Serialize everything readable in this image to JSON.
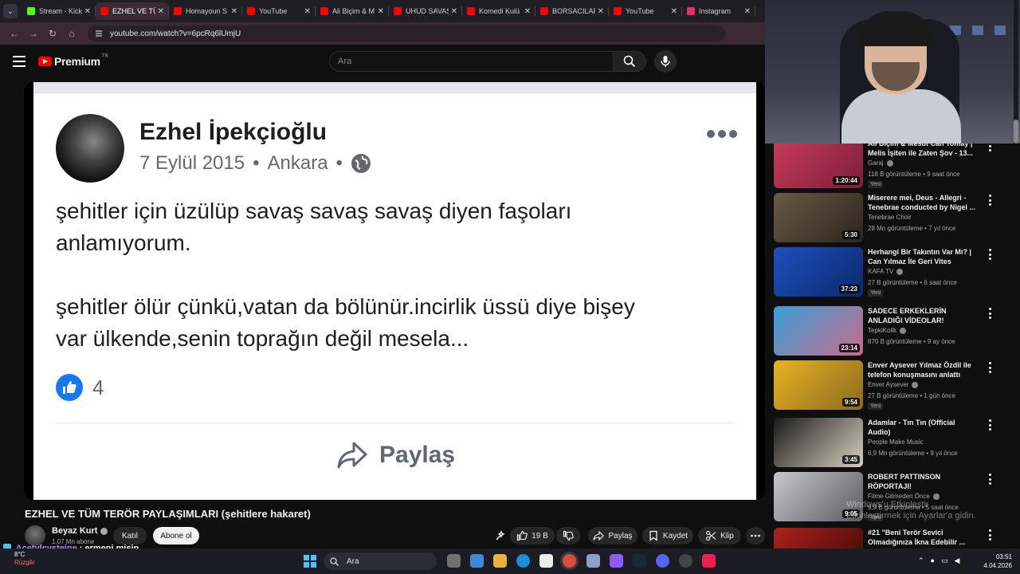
{
  "browser": {
    "tabs": [
      {
        "title": "Stream - Kick",
        "color": "#53fc18"
      },
      {
        "title": "EZHEL VE TÜ",
        "color": "#ff0000",
        "active": true
      },
      {
        "title": "Homayoun S",
        "color": "#ff0000"
      },
      {
        "title": "YouTube",
        "color": "#ff0000"
      },
      {
        "title": "Ali Biçim & M",
        "color": "#ff0000"
      },
      {
        "title": "UHUD SAVAŞ",
        "color": "#ff0000"
      },
      {
        "title": "Komedi Kulü",
        "color": "#ff0000"
      },
      {
        "title": "BORSACILAR",
        "color": "#ff0000"
      },
      {
        "title": "YouTube",
        "color": "#ff0000"
      },
      {
        "title": "Instagram",
        "color": "#e1306c"
      }
    ],
    "url": "youtube.com/watch?v=6pcRq6lUmjU"
  },
  "youtube": {
    "logo_text": "Premium",
    "logo_badge": "TR",
    "search_placeholder": "Ara"
  },
  "post": {
    "author": "Ezhel İpekçioğlu",
    "date": "7 Eylül 2015",
    "location": "Ankara",
    "dot": "•",
    "text": "şehitler için üzülüp savaş savaş savaş diyen faşoları\nanlamıyorum.\n\nşehitler ölür çünkü,vatan da bölünür.incirlik üssü diye bişey\nvar ülkende,senin toprağın değil mesela...",
    "likes": "4",
    "share_label": "Paylaş"
  },
  "video": {
    "title": "EZHEL VE TÜM TERÖR PAYLAŞIMLARI (şehitlere hakaret)",
    "channel": "Beyaz Kurt",
    "subscribers": "1,07 Mn abone",
    "join_label": "Katıl",
    "subscribe_label": "Abone ol",
    "like_count": "19 B",
    "share_label": "Paylaş",
    "save_label": "Kaydet",
    "clip_label": "Klip"
  },
  "chat": {
    "user": "Acetylcysteine",
    "sep": ":",
    "message": "ermeni misin"
  },
  "recommendations": [
    {
      "title": "Ali Biçim & Mesut Can Tomay | Melis İşiten ile Zaten Şov - 13...",
      "channel": "Garaj",
      "verified": true,
      "views": "118 B görüntüleme • 9 saat önce",
      "badge": "Yeni",
      "duration": "1:20:44",
      "thumb": [
        "#c93b5a",
        "#7a1f3a"
      ]
    },
    {
      "title": "Miserere mei, Deus - Allegri - Tenebrae conducted by Nigel ...",
      "channel": "Tenebrae Choir",
      "verified": false,
      "views": "28 Mn görüntüleme • 7 yıl önce",
      "badge": "",
      "duration": "5:30",
      "thumb": [
        "#6a5a48",
        "#2c241c"
      ]
    },
    {
      "title": "Herhangi Bir Takıntın Var Mı? | Can Yılmaz İle Geri Vites",
      "channel": "KAFA TV",
      "verified": true,
      "views": "27 B görüntüleme • 6 saat önce",
      "badge": "Yeni",
      "duration": "37:23",
      "thumb": [
        "#1e4fbf",
        "#0b2a6e"
      ]
    },
    {
      "title": "SADECE ERKEKLERİN ANLADIĞI VİDEOLAR!",
      "channel": "TepkiKolik",
      "verified": true,
      "views": "870 B görüntüleme • 9 ay önce",
      "badge": "",
      "duration": "23:14",
      "thumb": [
        "#3aa0d8",
        "#c96a8a"
      ]
    },
    {
      "title": "Enver Aysever Yılmaz Özdil ile telefon konuşmasını anlattı",
      "channel": "Enver Aysever",
      "verified": true,
      "views": "27 B görüntüleme • 1 gün önce",
      "badge": "Yeni",
      "duration": "9:54",
      "thumb": [
        "#e8b321",
        "#8a6a20"
      ]
    },
    {
      "title": "Adamlar - Tın Tın (Official Audio)",
      "channel": "People Make Music",
      "verified": false,
      "views": "6,9 Mn görüntüleme • 9 yıl önce",
      "badge": "",
      "duration": "3:45",
      "thumb": [
        "#1a1a1a",
        "#d8d0c0"
      ]
    },
    {
      "title": "ROBERT PATTINSON RÖPORTAJI!",
      "channel": "Filme Gitmeden Önce",
      "verified": true,
      "views": "9,9 B görüntüleme • 5 saat önce",
      "badge": "Yeni",
      "duration": "9:05",
      "thumb": [
        "#c8c8cc",
        "#5a5a60"
      ]
    },
    {
      "title": "#21 \"Beni Terör Sevici Olmadığınıza İkna Edebilir ...",
      "channel": "",
      "verified": false,
      "views": "",
      "badge": "",
      "duration": "",
      "thumb": [
        "#b0201c",
        "#3a0a08"
      ]
    }
  ],
  "watermark": {
    "line1": "Windows'u Etkinleştir",
    "line2": "Etkinleştirmek için Ayarlar'a gidin."
  },
  "taskbar": {
    "temp": "8°C",
    "condition": "Rüzgâr",
    "search_label": "Ara",
    "time": "03:51",
    "date": "4.04.2026"
  },
  "colors": {
    "yt_red": "#ff0000",
    "fb_blue": "#1877f2",
    "bg": "#0f0f0f"
  }
}
